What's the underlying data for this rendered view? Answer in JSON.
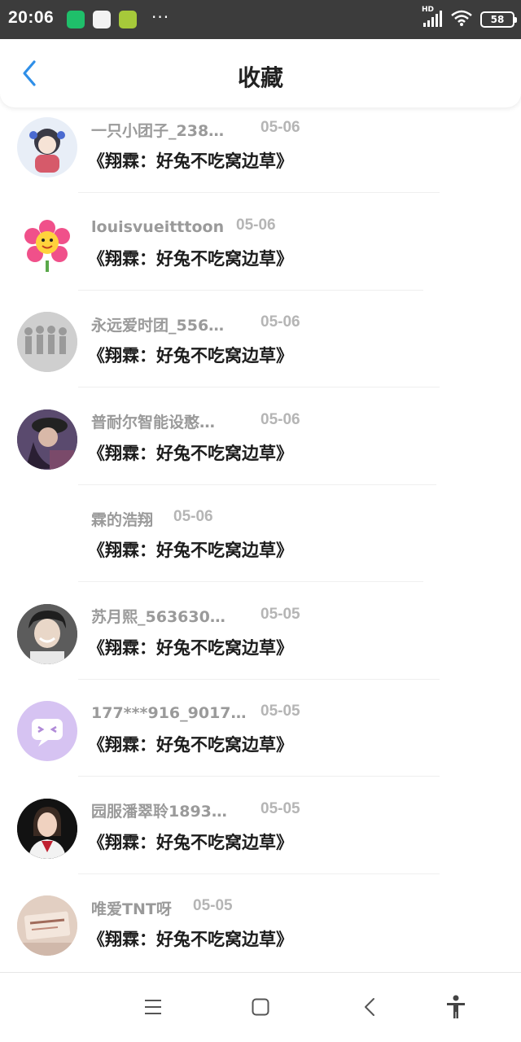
{
  "status_bar": {
    "time": "20:06",
    "more": "···",
    "signal_label": "HD",
    "battery": "58"
  },
  "header": {
    "title": "收藏"
  },
  "items": [
    {
      "username": "一只小团子_238…",
      "date": "05-06",
      "title": "《翔霖：好兔不吃窝边草》",
      "avatar_color": "#e8eef7"
    },
    {
      "username": "louisvueitttoon",
      "date": "05-06",
      "title": "《翔霖：好兔不吃窝边草》",
      "avatar_color": "#ffffff"
    },
    {
      "username": "永远爱时团_556…",
      "date": "05-06",
      "title": "《翔霖：好兔不吃窝边草》",
      "avatar_color": "#cfcfcf"
    },
    {
      "username": "普耐尔智能设憨…",
      "date": "05-06",
      "title": "《翔霖：好兔不吃窝边草》",
      "avatar_color": "#4a3b5a"
    },
    {
      "username": "霖的浩翔",
      "date": "05-06",
      "title": "《翔霖：好兔不吃窝边草》",
      "avatar_color": "#ffffff"
    },
    {
      "username": "苏月熙_563630…",
      "date": "05-05",
      "title": "《翔霖：好兔不吃窝边草》",
      "avatar_color": "#6b6b6b"
    },
    {
      "username": "177***916_9017…",
      "date": "05-05",
      "title": "《翔霖：好兔不吃窝边草》",
      "avatar_color": "#d6c3f2"
    },
    {
      "username": "园服潘翠聆1893…",
      "date": "05-05",
      "title": "《翔霖：好兔不吃窝边草》",
      "avatar_color": "#1a1a1a"
    },
    {
      "username": "唯爱TNT呀",
      "date": "05-05",
      "title": "《翔霖：好兔不吃窝边草》",
      "avatar_color": "#e6d6cc"
    }
  ],
  "colors": {
    "accent": "#2f8fe8",
    "status_bar_bg": "#3c3c3c"
  }
}
